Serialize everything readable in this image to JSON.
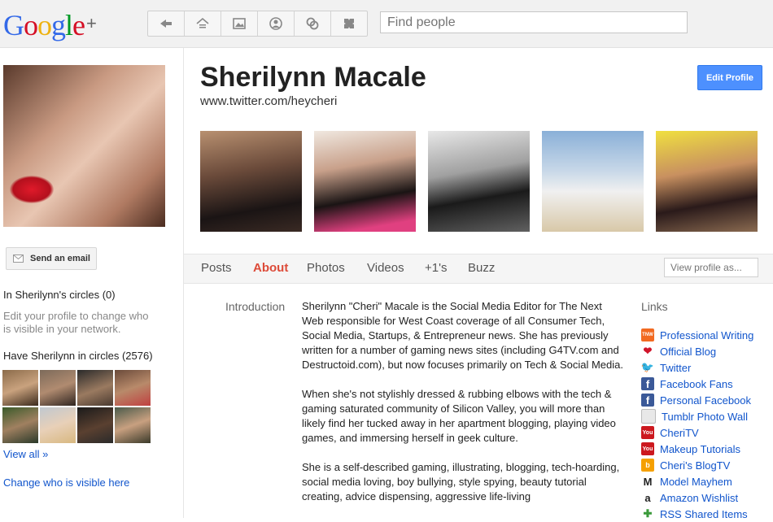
{
  "brand": {
    "logo_text": "Google",
    "logo_plus": "+"
  },
  "nav": {
    "icons": [
      "stream-icon",
      "home-icon",
      "photos-icon",
      "profile-icon",
      "circles-icon",
      "games-icon"
    ]
  },
  "search": {
    "placeholder": "Find people"
  },
  "profile": {
    "name": "Sherilynn Macale",
    "website": "www.twitter.com/heycheri",
    "edit_label": "Edit Profile"
  },
  "sidebar": {
    "send_email": "Send an email",
    "in_circles": "In Sherilynn's circles (0)",
    "edit_hint": "Edit your profile to change who is visible in your network.",
    "have_in_circles": "Have Sherilynn in circles (2576)",
    "view_all": "View all »",
    "change_visible": "Change who is visible here"
  },
  "tabs": [
    {
      "label": "Posts"
    },
    {
      "label": "About",
      "active": true
    },
    {
      "label": "Photos"
    },
    {
      "label": "Videos"
    },
    {
      "label": "+1's"
    },
    {
      "label": "Buzz"
    }
  ],
  "view_as": {
    "placeholder": "View profile as..."
  },
  "about": {
    "intro_label": "Introduction",
    "paragraphs": [
      "Sherilynn \"Cheri\" Macale is the Social Media Editor for The Next Web responsible for West Coast coverage of all Consumer Tech, Social Media, Startups, & Entrepreneur news. She has previously written for a number of gaming news sites (including G4TV.com and Destructoid.com), but now focuses primarily on Tech & Social Media.",
      "When she's not stylishly dressed & rubbing elbows with the tech & gaming saturated community of Silicon Valley, you will more than likely find her tucked away in her apartment blogging, playing video games, and immersing herself in geek culture.",
      "She is a self-described gaming, illustrating, blogging, tech-hoarding, social media loving, boy bullying, style spying, beauty tutorial creating, advice dispensing, aggressive life-living"
    ]
  },
  "links": {
    "heading": "Links",
    "items": [
      {
        "label": "Professional Writing",
        "icon": "tnw-icon",
        "color": "#f26a21",
        "glyph": "TNW"
      },
      {
        "label": "Official Blog",
        "icon": "heart-icon",
        "color": "#ffffff",
        "glyph": "❤"
      },
      {
        "label": "Twitter",
        "icon": "twitter-icon",
        "color": "#ffffff",
        "glyph": "🐦"
      },
      {
        "label": "Facebook Fans",
        "icon": "facebook-icon",
        "color": "#3b5998",
        "glyph": "f"
      },
      {
        "label": "Personal Facebook",
        "icon": "facebook-icon",
        "color": "#3b5998",
        "glyph": "f"
      },
      {
        "label": "Tumblr Photo Wall",
        "icon": "page-icon",
        "color": "#e8e8e8",
        "glyph": ""
      },
      {
        "label": "CheriTV",
        "icon": "youtube-icon",
        "color": "#cc181e",
        "glyph": "You"
      },
      {
        "label": "Makeup Tutorials",
        "icon": "youtube-icon",
        "color": "#cc181e",
        "glyph": "You"
      },
      {
        "label": "Cheri's BlogTV",
        "icon": "blogtv-icon",
        "color": "#f5a000",
        "glyph": "b"
      },
      {
        "label": "Model Mayhem",
        "icon": "modelmayhem-icon",
        "color": "#ffffff",
        "glyph": "M"
      },
      {
        "label": "Amazon Wishlist",
        "icon": "amazon-icon",
        "color": "#ffffff",
        "glyph": "a"
      },
      {
        "label": "RSS Shared Items",
        "icon": "rss-icon",
        "color": "#ffffff",
        "glyph": "✚"
      }
    ]
  },
  "colors": {
    "link": "#1155cc",
    "active_tab": "#dd4b39",
    "edit_button": "#4d90fe"
  }
}
